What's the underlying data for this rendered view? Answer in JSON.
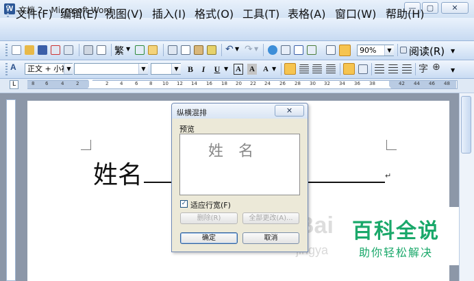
{
  "window": {
    "title": "文档 2 - Microsoft Word",
    "app_icon_letter": "W",
    "minimize": "—",
    "maximize": "▢",
    "close": "✕"
  },
  "menubar": {
    "items": [
      "文件(F)",
      "编辑(E)",
      "视图(V)",
      "插入(I)",
      "格式(O)",
      "工具(T)",
      "表格(A)",
      "窗口(W)",
      "帮助(H)"
    ]
  },
  "toolbar_standard": {
    "language_button": "繁",
    "zoom_value": "90%",
    "read_button": "阅读(R)"
  },
  "toolbar_formatting": {
    "style_value": "正文 + 小初",
    "font_value": "",
    "size_value": "",
    "bold": "B",
    "italic": "I",
    "underline": "U",
    "char_border": "A",
    "char_shading": "A",
    "char_scale": "A"
  },
  "ruler": {
    "corner": "L",
    "labels": [
      "8",
      "6",
      "4",
      "2",
      "2",
      "4",
      "6",
      "8",
      "10",
      "12",
      "14",
      "16",
      "18",
      "20",
      "22",
      "24",
      "26",
      "28",
      "30",
      "32",
      "34",
      "36",
      "38",
      "42",
      "44",
      "46",
      "48"
    ]
  },
  "document": {
    "text": "姓名",
    "paragraph_mark": "↵"
  },
  "dialog": {
    "title": "纵横混排",
    "close": "✕",
    "preview_label": "预览",
    "preview_glyphs": [
      "姓",
      "名"
    ],
    "fit_line_label": "适应行宽(F)",
    "fit_line_checked": true,
    "delete_button": "删除(R)",
    "change_all_button": "全部更改(A)...",
    "ok_button": "确定",
    "cancel_button": "取消"
  },
  "watermark": {
    "logo": "Bai",
    "url": "jingya",
    "title": "百科全说",
    "subtitle": "助你轻松解决"
  },
  "colors": {
    "watermark_green": "#1aa86a",
    "titlebar": "#d2e2f4",
    "dialog_bg": "#ece9d8"
  }
}
